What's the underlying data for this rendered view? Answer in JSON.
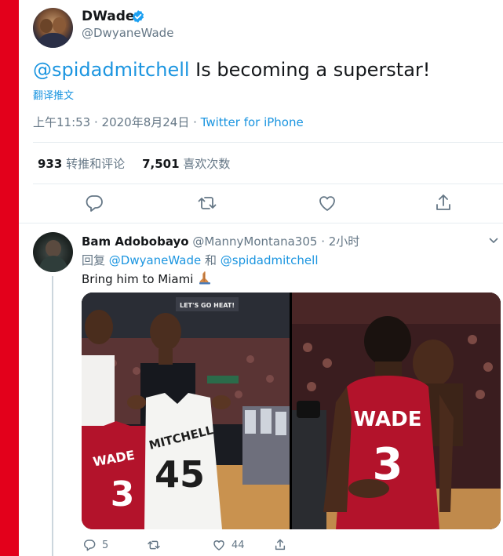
{
  "tweet": {
    "author_name": "DWade",
    "author_handle": "@DwyaneWade",
    "mention": "@spidadmitchell",
    "text_rest": " Is becoming a superstar!",
    "translate_label": "翻译推文",
    "time": "上午11:53 · 2020年8月24日 · ",
    "source": "Twitter for iPhone",
    "retweets_count": "933",
    "retweets_label": "转推和评论",
    "likes_count": "7,501",
    "likes_label": "喜欢次数",
    "icons": [
      "reply-icon",
      "retweet-icon",
      "like-icon",
      "share-icon"
    ]
  },
  "reply": {
    "author_name": "Bam Adobobayo",
    "author_handle": "@MannyMontana305",
    "time": " · 2小时",
    "replying_prefix": "回复 ",
    "replying_to_1": "@DwyaneWade",
    "replying_and": " 和 ",
    "replying_to_2": "@spidadmitchell",
    "text": "Bring him to Miami",
    "reply_count": "5",
    "like_count": "44"
  },
  "media": {
    "left_photo": {
      "scoreboard_text": "LET'S GO HEAT!",
      "jersey_1_name": "WADE",
      "jersey_1_number": "3",
      "jersey_2_name": "MITCHELL",
      "jersey_2_number": "45"
    },
    "right_photo": {
      "jersey_name": "WADE",
      "jersey_number": "3"
    }
  },
  "colors": {
    "accent": "#1b95e0",
    "verified": "#1da1f2",
    "left_bar": "#e3001b",
    "heat_red": "#b3132b"
  }
}
